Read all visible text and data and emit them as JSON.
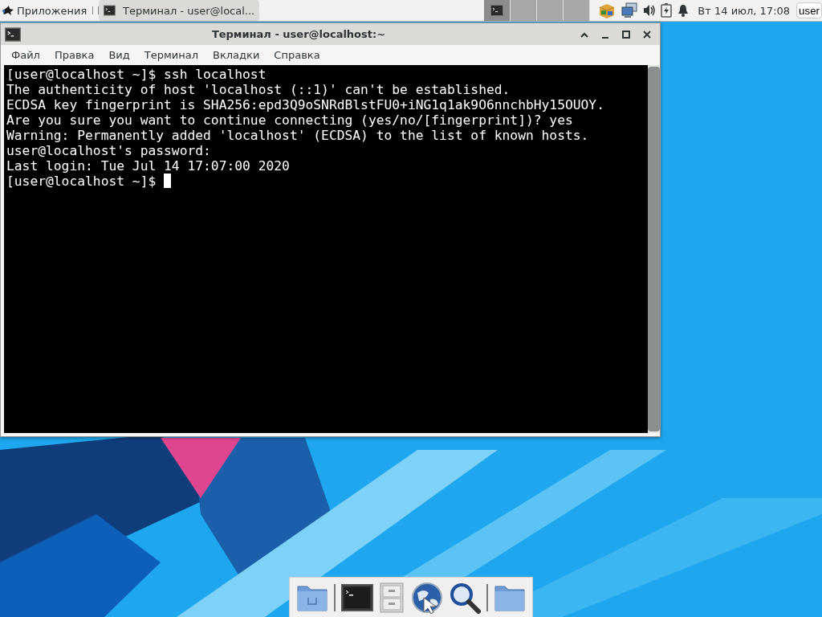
{
  "panel": {
    "apps_menu": "Приложения",
    "taskbar": [
      {
        "label": "Терминал - user@local...",
        "selected": true
      }
    ],
    "workspaces": [
      {
        "selected": true,
        "has_window": true
      },
      {
        "selected": false,
        "has_window": false
      },
      {
        "selected": false,
        "has_window": false
      },
      {
        "selected": false,
        "has_window": false
      }
    ],
    "clock": "Вт 14 июл, 17:08",
    "user": "user"
  },
  "window": {
    "title": "Терминал - user@localhost:~",
    "menu": [
      "Файл",
      "Правка",
      "Вид",
      "Терминал",
      "Вкладки",
      "Справка"
    ],
    "terminal": {
      "cursor_visible": true,
      "lines": [
        "[user@localhost ~]$ ssh localhost",
        "The authenticity of host 'localhost (::1)' can't be established.",
        "ECDSA key fingerprint is SHA256:epd3Q9oSNRdBlstFU0+iNG1q1ak9O6nnchbHy15OUOY.",
        "Are you sure you want to continue connecting (yes/no/[fingerprint])? yes",
        "Warning: Permanently added 'localhost' (ECDSA) to the list of known hosts.",
        "user@localhost's password:",
        "Last login: Tue Jul 14 17:07:00 2020",
        "[user@localhost ~]$ "
      ]
    }
  }
}
